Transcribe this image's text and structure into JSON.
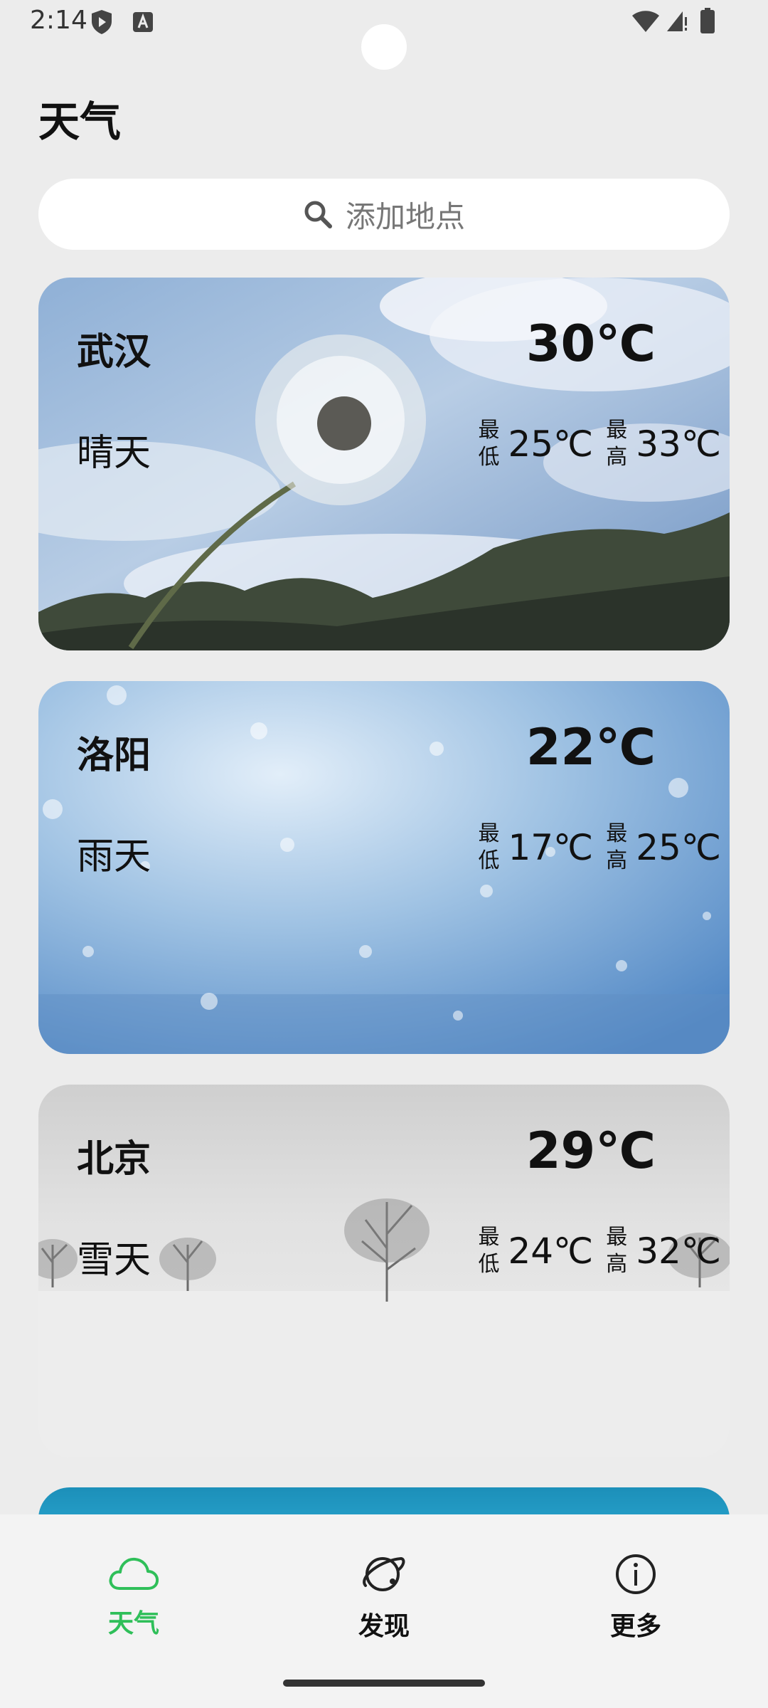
{
  "status_bar": {
    "time": "2:14",
    "icons": [
      "shield-play-icon",
      "font-a-icon",
      "wifi-icon",
      "signal-icon",
      "battery-icon"
    ]
  },
  "page": {
    "title": "天气"
  },
  "search": {
    "icon": "search-icon",
    "placeholder": "添加地点"
  },
  "cities": [
    {
      "name": "武汉",
      "condition": "晴天",
      "temp": "30℃",
      "min_label": "最低",
      "min": "25℃",
      "max_label": "最高",
      "max": "33℃",
      "background": "sunny-sky-dandelion"
    },
    {
      "name": "洛阳",
      "condition": "雨天",
      "temp": "22℃",
      "min_label": "最低",
      "min": "17℃",
      "max_label": "最高",
      "max": "25℃",
      "background": "rain-drops-glass"
    },
    {
      "name": "北京",
      "condition": "雪天",
      "temp": "29℃",
      "min_label": "最低",
      "min": "24℃",
      "max_label": "最高",
      "max": "32℃",
      "background": "snowy-field-trees"
    }
  ],
  "nav": {
    "items": [
      {
        "label": "天气",
        "icon": "cloud-icon",
        "active": true
      },
      {
        "label": "发现",
        "icon": "planet-icon",
        "active": false
      },
      {
        "label": "更多",
        "icon": "info-icon",
        "active": false
      }
    ],
    "active_color": "#2fbf59"
  }
}
